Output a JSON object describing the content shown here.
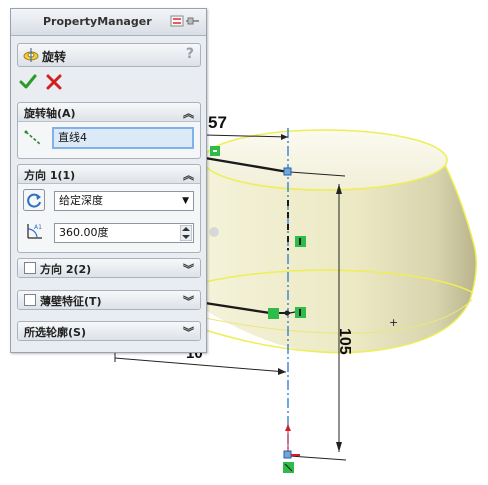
{
  "window": {
    "title": "PropertyManager"
  },
  "feature": {
    "name": "旋转",
    "help": "?"
  },
  "actions": {
    "ok": "ok",
    "cancel": "cancel"
  },
  "axis_group": {
    "title": "旋转轴(A)",
    "value": "直线4"
  },
  "direction1": {
    "title": "方向 1(1)",
    "end_condition": "给定深度",
    "angle": "360.00度"
  },
  "direction2": {
    "title": "方向 2(2)"
  },
  "thin_feature": {
    "title": "薄壁特征(T)"
  },
  "contours": {
    "title": "所选轮廓(S)"
  },
  "dimensions": {
    "top": "57",
    "vertical": "105",
    "partial": "10"
  },
  "colors": {
    "edge_yellow": "#f0f06a",
    "body_fill": "#e6e3b8",
    "axis_blue": "#3a7fd0",
    "accent_green": "#2dbb4a"
  }
}
